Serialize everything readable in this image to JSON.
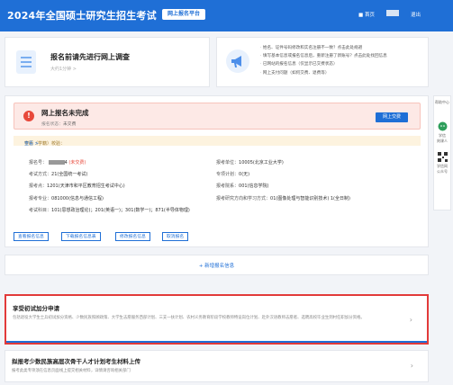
{
  "header": {
    "title": "2024年全国硕士研究生招生考试",
    "platform_badge": "网上报名平台",
    "home_link": "■ 首页",
    "logout_link": "退出"
  },
  "survey": {
    "heading": "报名前请先进行网上调查",
    "subtext": "大约1分钟 >"
  },
  "notices": [
    "姓名、证件号码修改和实名注册不一致？点击此处规避",
    "填写基本信息或报名信息后，重新注册了新账号？点击此处找回信息",
    "已网站的报名信息（仅显示已交费状态）",
    "网上支付问题（如何交费、退费等）"
  ],
  "status": {
    "title": "网上报名未完成",
    "sub_label": "报名状态：",
    "sub_value": "未交费",
    "pay_button": "网上交费"
  },
  "education": {
    "label": "学历（学籍）校验：",
    "link": "查看 >"
  },
  "fields": {
    "reg_no_label": "报名号：",
    "reg_no_suffix": "4",
    "reg_no_status": "(未交费)",
    "exam_type_label": "考试方式：",
    "exam_type_value": "21(全国统一考试)",
    "test_site_label": "报考点：",
    "test_site_value": "1201(天津市和平区教育招生考试中心)",
    "major_label": "报考专业：",
    "major_value": "081000(信息与通信工程)",
    "subjects_label": "考试科目：",
    "subjects_value": "101(思想政治理论)；201(英语一)；301(数学一)；871(半导体物理)",
    "unit_label": "报考单位：",
    "unit_value": "10005(北京工业大学)",
    "plan_label": "专项计划：",
    "plan_value": "0(无)",
    "dept_label": "报考院系：",
    "dept_value": "001(信息学院)",
    "direction_label": "报考研究方向和学习方式：",
    "direction_value": "01(图像处理与智能识别技术) 1(全日制)"
  },
  "actions": [
    "查看报名信息",
    "下载报名信息表",
    "修改报名信息",
    "取消报名"
  ],
  "add_button": "+ 新增报名信息",
  "bonus": {
    "title": "享受初试加分申请",
    "desc": "包括退役大学生士兵初试加分资格、少数民族照顾政策、大学生志愿服务西部计划、三支一扶计划、农村义务教育阶段学校教师特设岗位计划、赴外汉语教师志愿者、选聘高校毕业生到村任职加分资格。"
  },
  "minority": {
    "title": "拟报考少数民族高层次骨干人才计划考生材料上传",
    "desc": "报考此类专项须在信息页面线上提交相关材料，详情请咨询相关部门"
  },
  "side": {
    "help": "帮助中心",
    "wechat": "学信\n刻课人",
    "qr": "学信网\n公众号"
  },
  "colors": {
    "brand": "#1f6fd6",
    "alert": "#e8483a",
    "highlight_border": "#e23a3a"
  }
}
